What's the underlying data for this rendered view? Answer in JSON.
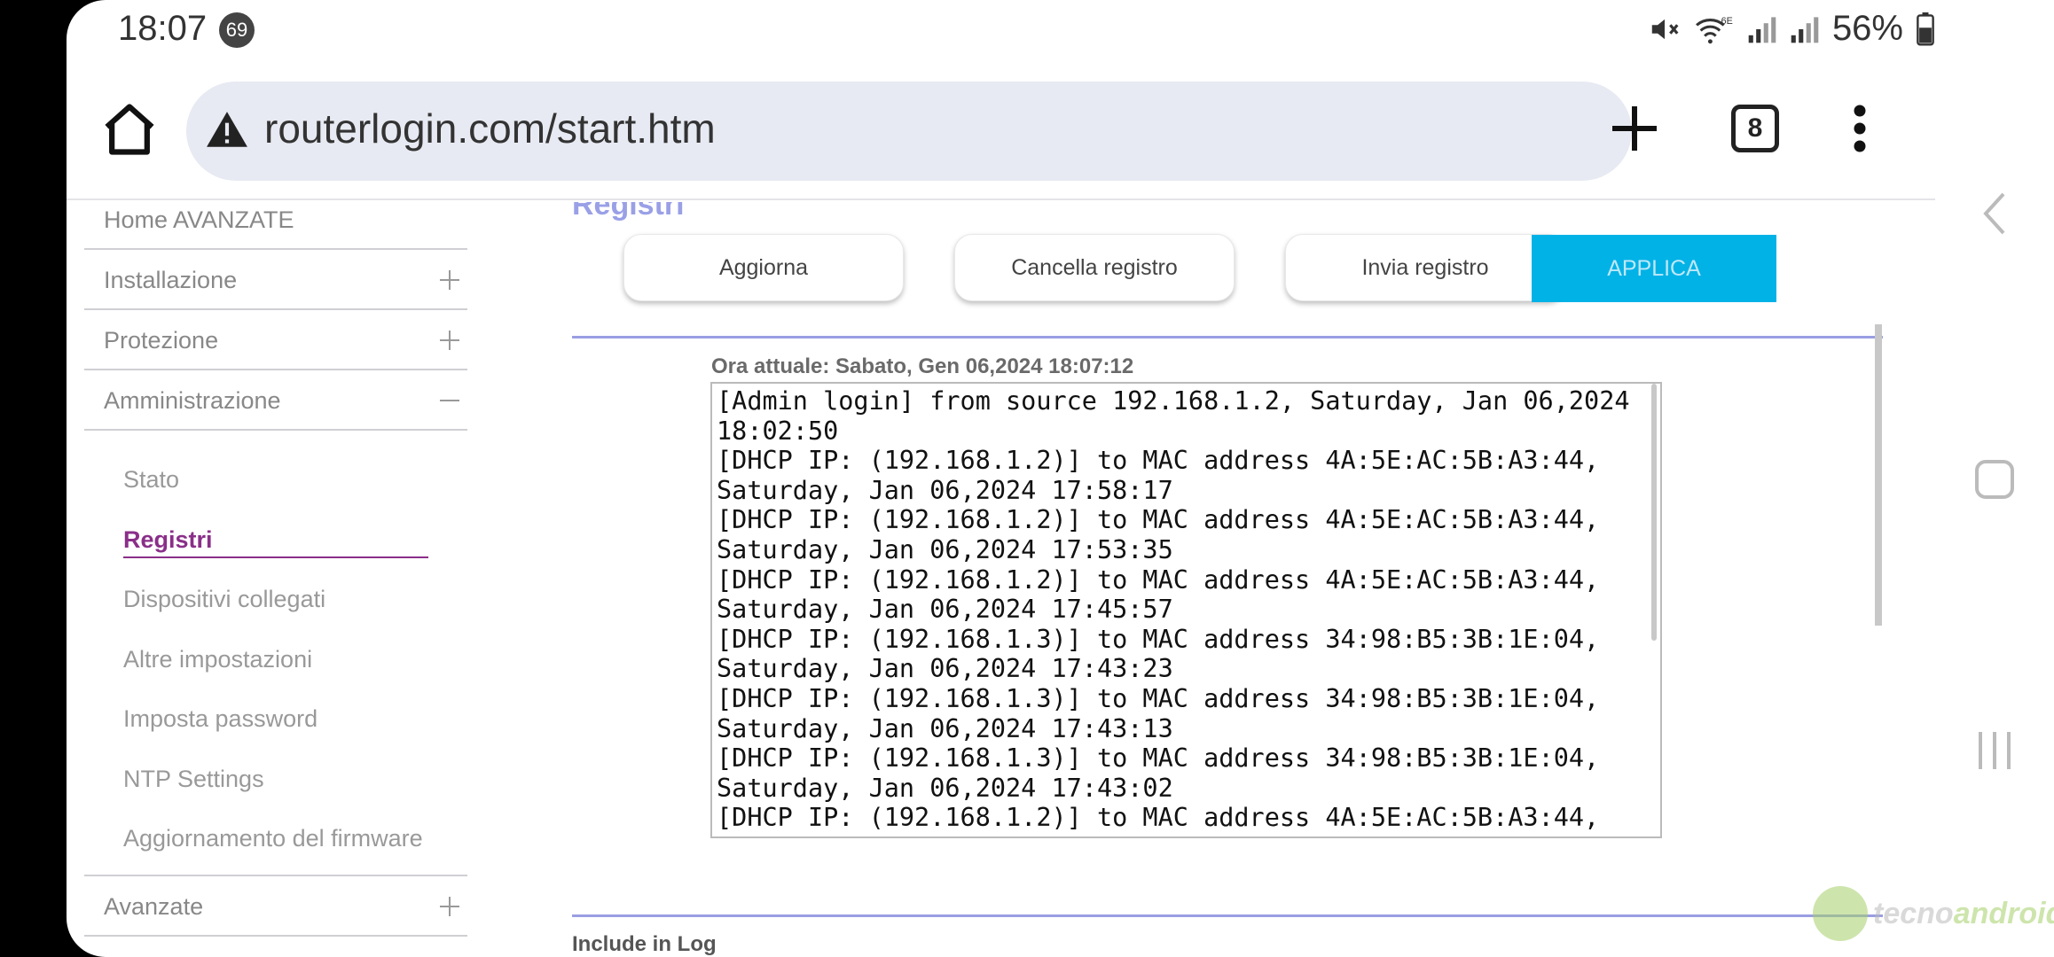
{
  "status": {
    "time": "18:07",
    "notifications": "69",
    "battery": "56%"
  },
  "browser": {
    "url": "routerlogin.com/start.htm",
    "tab_count": "8"
  },
  "sidebar": {
    "home": "Home AVANZATE",
    "sections": [
      {
        "label": "Installazione"
      },
      {
        "label": "Protezione"
      },
      {
        "label": "Amministrazione"
      }
    ],
    "sub_items": [
      {
        "label": "Stato"
      },
      {
        "label": "Registri"
      },
      {
        "label": "Dispositivi collegati"
      },
      {
        "label": "Altre impostazioni"
      },
      {
        "label": "Imposta password"
      },
      {
        "label": "NTP Settings"
      },
      {
        "label": "Aggiornamento del firmware"
      }
    ],
    "advanced": "Avanzate"
  },
  "main": {
    "title": "Registri",
    "buttons": {
      "refresh": "Aggiorna",
      "clear": "Cancella registro",
      "send": "Invia registro",
      "apply": "APPLICA"
    },
    "current_time": "Ora attuale: Sabato, Gen 06,2024 18:07:12",
    "log": "[Admin login] from source 192.168.1.2, Saturday, Jan 06,2024 18:02:50\n[DHCP IP: (192.168.1.2)] to MAC address 4A:5E:AC:5B:A3:44, Saturday, Jan 06,2024 17:58:17\n[DHCP IP: (192.168.1.2)] to MAC address 4A:5E:AC:5B:A3:44, Saturday, Jan 06,2024 17:53:35\n[DHCP IP: (192.168.1.2)] to MAC address 4A:5E:AC:5B:A3:44, Saturday, Jan 06,2024 17:45:57\n[DHCP IP: (192.168.1.3)] to MAC address 34:98:B5:3B:1E:04, Saturday, Jan 06,2024 17:43:23\n[DHCP IP: (192.168.1.3)] to MAC address 34:98:B5:3B:1E:04, Saturday, Jan 06,2024 17:43:13\n[DHCP IP: (192.168.1.3)] to MAC address 34:98:B5:3B:1E:04, Saturday, Jan 06,2024 17:43:02\n[DHCP IP: (192.168.1.2)] to MAC address 4A:5E:AC:5B:A3:44,",
    "include_label": "Include in Log"
  },
  "watermark": {
    "part1": "tecno",
    "part2": "android"
  }
}
